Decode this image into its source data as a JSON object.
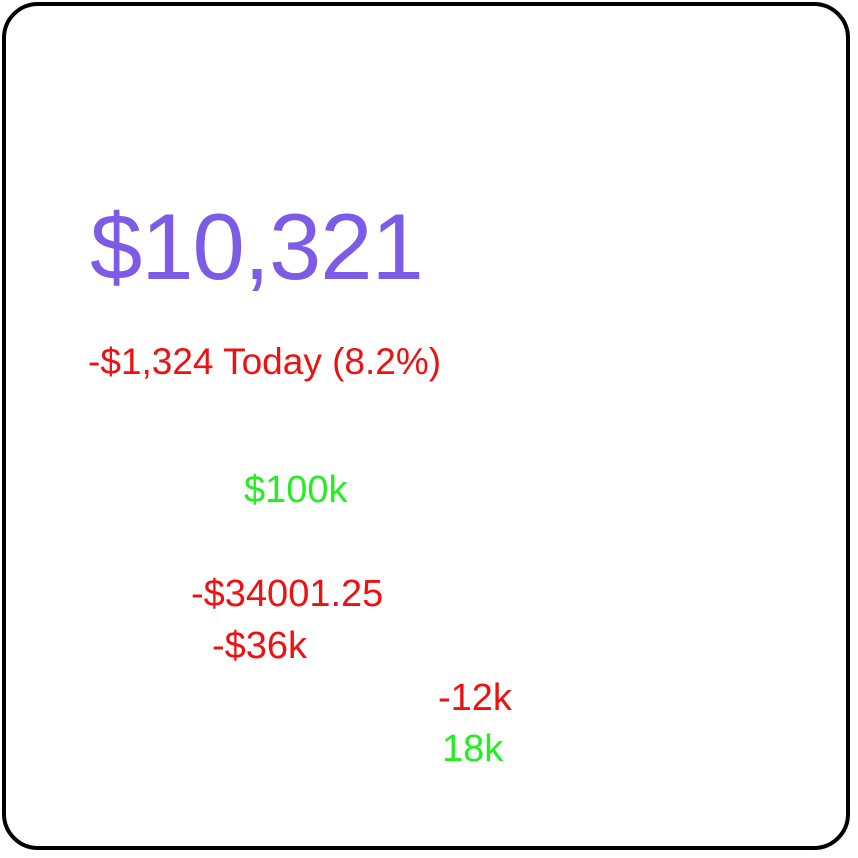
{
  "portfolio": {
    "balance": "$10,321",
    "change_today": "-$1,324 Today (8.2%)"
  },
  "values": [
    {
      "text": "$100k",
      "color": "#22ee22",
      "trend": "up"
    },
    {
      "text": "-$34001.25",
      "color": "#ee1111",
      "trend": "down"
    },
    {
      "text": "-$36k",
      "color": "#ee1111",
      "trend": "down"
    },
    {
      "text": "-12k",
      "color": "#ee1111",
      "trend": "down"
    },
    {
      "text": "18k",
      "color": "#22ee22",
      "trend": "up"
    }
  ],
  "colors": {
    "balance": "#7c5ce6",
    "negative": "#ee1111",
    "positive": "#22ee22",
    "border": "#000000"
  }
}
